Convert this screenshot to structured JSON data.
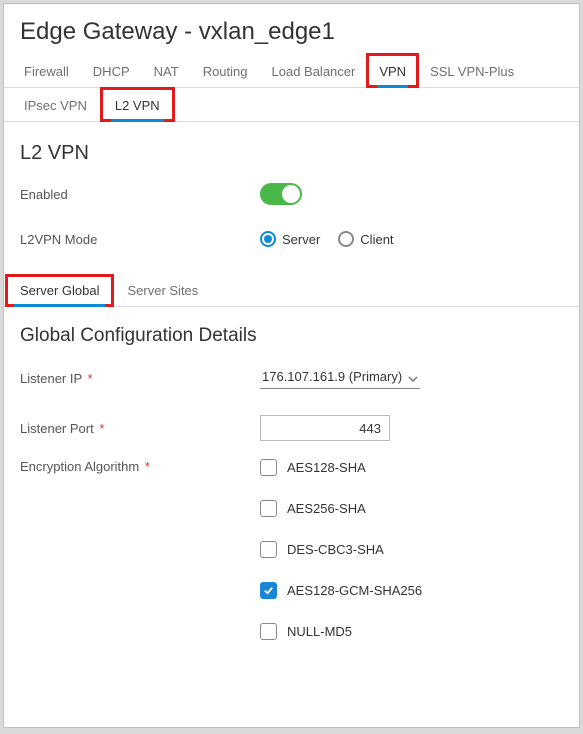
{
  "page_title": "Edge Gateway - vxlan_edge1",
  "top_tabs": {
    "firewall": "Firewall",
    "dhcp": "DHCP",
    "nat": "NAT",
    "routing": "Routing",
    "load_balancer": "Load Balancer",
    "vpn": "VPN",
    "ssl_vpn_plus": "SSL VPN-Plus"
  },
  "sub_tabs": {
    "ipsec_vpn": "IPsec VPN",
    "l2_vpn": "L2 VPN"
  },
  "section_title": "L2 VPN",
  "enabled_label": "Enabled",
  "enabled_value": true,
  "mode_label": "L2VPN Mode",
  "mode_options": {
    "server": "Server",
    "client": "Client"
  },
  "mode_selected": "server",
  "low_tabs": {
    "server_global": "Server Global",
    "server_sites": "Server Sites"
  },
  "panel_title": "Global Configuration Details",
  "listener_ip_label": "Listener IP",
  "listener_ip_value": "176.107.161.9 (Primary)",
  "listener_port_label": "Listener Port",
  "listener_port_value": "443",
  "encryption_label": "Encryption Algorithm",
  "encryption_options": [
    {
      "label": "AES128-SHA",
      "checked": false
    },
    {
      "label": "AES256-SHA",
      "checked": false
    },
    {
      "label": "DES-CBC3-SHA",
      "checked": false
    },
    {
      "label": "AES128-GCM-SHA256",
      "checked": true
    },
    {
      "label": "NULL-MD5",
      "checked": false
    }
  ],
  "required_marker": "*"
}
